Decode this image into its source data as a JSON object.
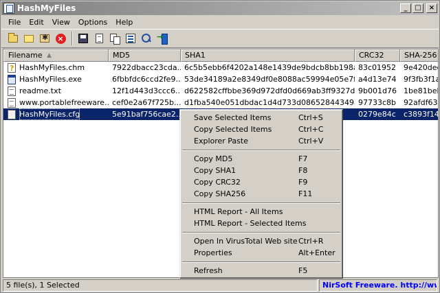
{
  "window": {
    "title": "HashMyFiles",
    "buttons": {
      "minimize": "_",
      "maximize": "□",
      "close": "×"
    }
  },
  "menu": {
    "items": [
      "File",
      "Edit",
      "View",
      "Options",
      "Help"
    ]
  },
  "toolbar": {
    "icons": [
      "open-files-icon",
      "open-folder-icon",
      "add-wildcard-icon",
      "stop-icon",
      "save-icon",
      "html-report-icon",
      "copy-icon",
      "properties-icon",
      "find-icon",
      "exit-icon"
    ]
  },
  "table": {
    "columns": [
      "Filename",
      "MD5",
      "SHA1",
      "CRC32",
      "SHA-256"
    ],
    "sort_indicator": "▲",
    "rows": [
      {
        "name": "HashMyFiles.chm",
        "icon": "chm",
        "md5": "7922dbacc23cda...",
        "sha1": "6c5b5ebb6f4202a148e1439de9bdcb8bb198a7ac",
        "crc32": "83c01952",
        "sha256": "9e420dec"
      },
      {
        "name": "HashMyFiles.exe",
        "icon": "exe",
        "md5": "6fbbfdc6ccd2fe9...",
        "sha1": "53de34189a2e8349df0e8088ac59994e05e7fecd",
        "crc32": "a4d13e74",
        "sha256": "9f3fb3f1a"
      },
      {
        "name": "readme.txt",
        "icon": "txt",
        "md5": "12f1d443d3ccc6...",
        "sha1": "d622582cffbbe369d972dfd0d669ab3ff9327d56",
        "crc32": "9b001d76",
        "sha256": "1be81beba"
      },
      {
        "name": "www.portablefreeware...",
        "icon": "txt",
        "md5": "cef0e2a67f725b...",
        "sha1": "d1fba540e051dbdac1d4d733d08652844349af5e",
        "crc32": "97733c8b",
        "sha256": "92afdf63c"
      },
      {
        "name": "HashMyFiles.cfg",
        "icon": "cfg",
        "md5": "5e91baf756cae2...",
        "sha1": "",
        "crc32": "0279e84c",
        "sha256": "c3893f143",
        "selected": true
      }
    ]
  },
  "context_menu": {
    "groups": [
      [
        {
          "label": "Save Selected Items",
          "key": "Ctrl+S"
        },
        {
          "label": "Copy Selected Items",
          "key": "Ctrl+C"
        },
        {
          "label": "Explorer Paste",
          "key": "Ctrl+V"
        }
      ],
      [
        {
          "label": "Copy MD5",
          "key": "F7"
        },
        {
          "label": "Copy SHA1",
          "key": "F8"
        },
        {
          "label": "Copy CRC32",
          "key": "F9"
        },
        {
          "label": "Copy SHA256",
          "key": "F11"
        }
      ],
      [
        {
          "label": "HTML Report - All Items",
          "key": ""
        },
        {
          "label": "HTML Report - Selected Items",
          "key": ""
        }
      ],
      [
        {
          "label": "Open In VirusTotal Web site",
          "key": "Ctrl+R"
        },
        {
          "label": "Properties",
          "key": "Alt+Enter"
        }
      ],
      [
        {
          "label": "Refresh",
          "key": "F5"
        }
      ]
    ]
  },
  "status": {
    "left": "5 file(s), 1 Selected",
    "right": "NirSoft Freeware.  http://www"
  }
}
